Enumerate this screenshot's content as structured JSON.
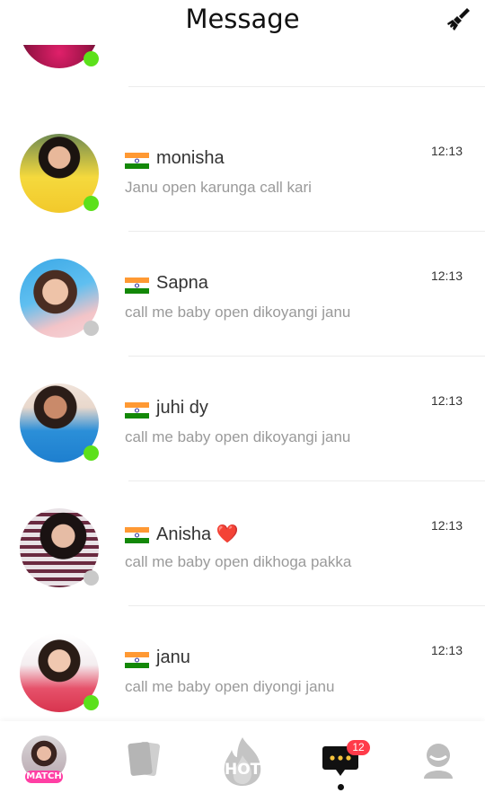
{
  "header": {
    "title": "Message",
    "clear_icon": "broom-icon"
  },
  "conversations": [
    {
      "name": "",
      "preview": "",
      "time": "",
      "status": "online",
      "flag": "india"
    },
    {
      "name": "monisha",
      "preview": "Janu open karunga call kari",
      "time": "12:13",
      "status": "online",
      "flag": "india"
    },
    {
      "name": "Sapna",
      "preview": "call me baby open dikoyangi janu",
      "time": "12:13",
      "status": "offline",
      "flag": "india"
    },
    {
      "name": "juhi dy",
      "preview": "call me baby open dikoyangi janu",
      "time": "12:13",
      "status": "online",
      "flag": "india"
    },
    {
      "name": "Anisha ❤️",
      "preview": "call me baby open dikhoga pakka",
      "time": "12:13",
      "status": "offline",
      "flag": "india"
    },
    {
      "name": "janu",
      "preview": "call me baby open diyongi  janu",
      "time": "12:13",
      "status": "online",
      "flag": "india"
    }
  ],
  "tabbar": {
    "match_label": "MATCH",
    "hot_label": "HOT",
    "messages_badge": "12",
    "active_tab": "messages",
    "icons": [
      "avatar-match-icon",
      "cards-icon",
      "hot-flame-icon",
      "chat-bubble-icon",
      "profile-icon"
    ]
  },
  "colors": {
    "online": "#5ce01b",
    "offline": "#c9c9c9",
    "badge": "#ff3b4a",
    "match_pink": "#ff3fa4"
  }
}
